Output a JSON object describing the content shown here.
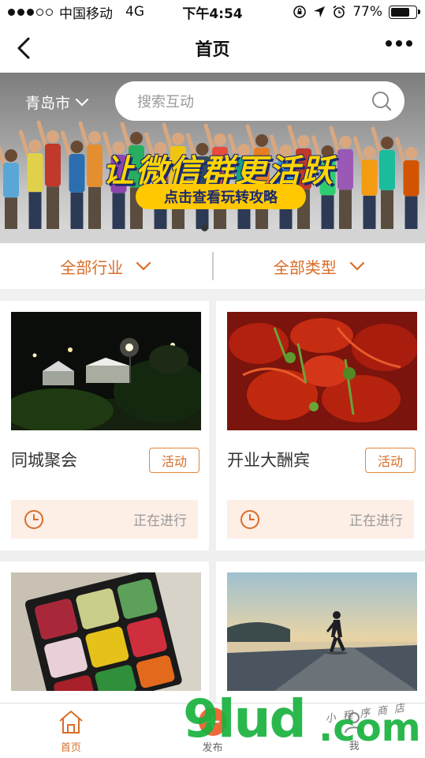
{
  "status_bar": {
    "carrier": "中国移动",
    "network": "4G",
    "time": "下午4:54",
    "battery": "77%",
    "battery_level": 0.77
  },
  "nav": {
    "title": "首页",
    "back_icon": "chevron-left-icon",
    "more_icon": "more-dots-icon"
  },
  "banner": {
    "city": "青岛市",
    "search_placeholder": "搜索互动",
    "slogan": "让微信群更活跃",
    "sub_slogan": "点击查看玩转攻略"
  },
  "filters": [
    {
      "label": "全部行业"
    },
    {
      "label": "全部类型"
    }
  ],
  "cards": [
    {
      "title": "同城聚会",
      "tag": "活动",
      "status": "正在进行",
      "image": "night-party-photo"
    },
    {
      "title": "开业大酬宾",
      "tag": "活动",
      "status": "正在进行",
      "image": "crayfish-photo"
    },
    {
      "title": "",
      "tag": "",
      "status": "",
      "image": "rubiks-cube-photo"
    },
    {
      "title": "",
      "tag": "",
      "status": "",
      "image": "runner-sunset-photo"
    }
  ],
  "tab_bar": [
    {
      "label": "首页",
      "icon": "home-icon",
      "active": true
    },
    {
      "label": "发布",
      "icon": "plus-icon",
      "active": false
    },
    {
      "label": "我",
      "icon": "user-icon",
      "active": false
    }
  ],
  "watermark": {
    "brand": "9lud",
    "domain": ".com",
    "caption": "小程序商店"
  },
  "colors": {
    "accent": "#d96d28",
    "status_bg": "#fdeee6",
    "watermark": "#18b23e"
  }
}
